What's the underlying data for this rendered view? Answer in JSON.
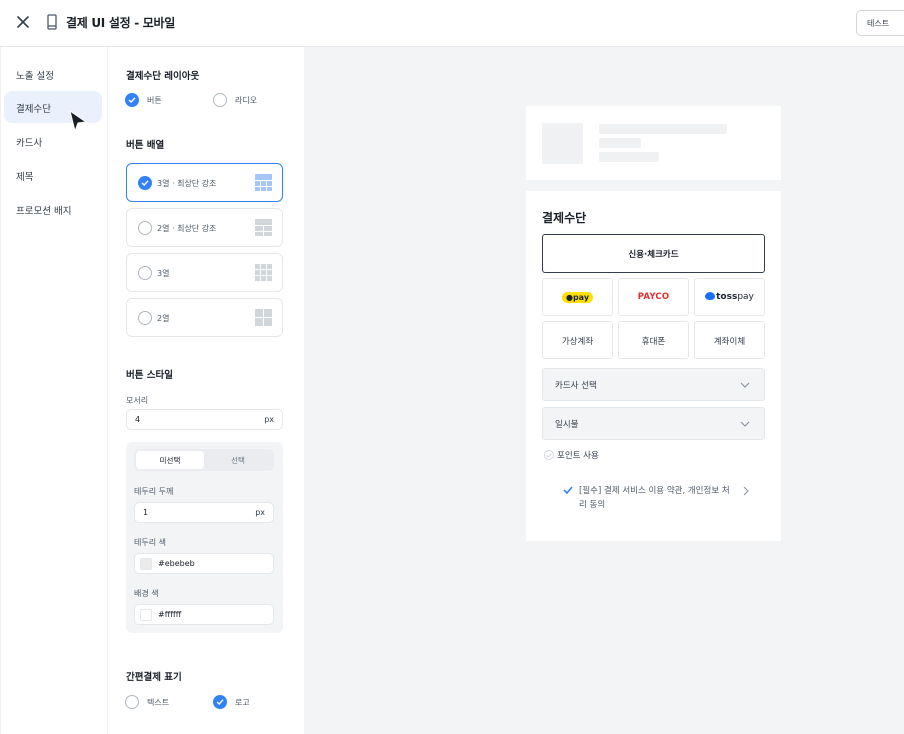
{
  "header": {
    "title": "결제 UI 설정 - 모바일",
    "test_button": "테스트"
  },
  "sidebar": {
    "items": [
      {
        "label": "노출 설정",
        "active": false
      },
      {
        "label": "결제수단",
        "active": true
      },
      {
        "label": "카드사",
        "active": false
      },
      {
        "label": "제목",
        "active": false
      },
      {
        "label": "프로모션 배지",
        "active": false
      }
    ]
  },
  "settings": {
    "layout": {
      "title": "결제수단 레이아웃",
      "options": [
        {
          "label": "버튼",
          "selected": true
        },
        {
          "label": "라디오",
          "selected": false
        }
      ]
    },
    "arrangement": {
      "title": "버튼 배열",
      "options": [
        {
          "label": "3열 · 최상단 강조",
          "selected": true
        },
        {
          "label": "2열 · 최상단 강조",
          "selected": false
        },
        {
          "label": "3열",
          "selected": false
        },
        {
          "label": "2열",
          "selected": false
        }
      ]
    },
    "style": {
      "title": "버튼 스타일",
      "corner_label": "모서리",
      "corner_value": "4",
      "unit": "px",
      "tabs": [
        {
          "label": "미선택",
          "active": true
        },
        {
          "label": "선택",
          "active": false
        }
      ],
      "border_width_label": "테두리 두께",
      "border_width_value": "1",
      "border_color_label": "테두리 색",
      "border_color_value": "#ebebeb",
      "bg_color_label": "배경 색",
      "bg_color_value": "#ffffff"
    },
    "easy_pay": {
      "title": "간편결제 표기",
      "options": [
        {
          "label": "텍스트",
          "selected": false
        },
        {
          "label": "로고",
          "selected": true
        }
      ]
    }
  },
  "preview": {
    "title": "결제수단",
    "primary_button": "신용·체크카드",
    "easy_pay": {
      "npay": "pay",
      "payco": "PAYCO",
      "toss_bold": "toss",
      "toss_light": "pay"
    },
    "methods": [
      "가상계좌",
      "휴대폰",
      "계좌이체"
    ],
    "card_select": "카드사 선택",
    "installment": "일시불",
    "point_label": "포인트 사용",
    "agreement": "[필수] 결제 서비스 이용 약관, 개인정보 처리 동의"
  },
  "colors": {
    "accent": "#3182f6",
    "border": "#e5e8eb",
    "preview_bg": "#f2f4f6",
    "payco_red": "#e72d2d",
    "npay_yellow": "#ffe000",
    "toss_blue": "#1a70f5"
  }
}
